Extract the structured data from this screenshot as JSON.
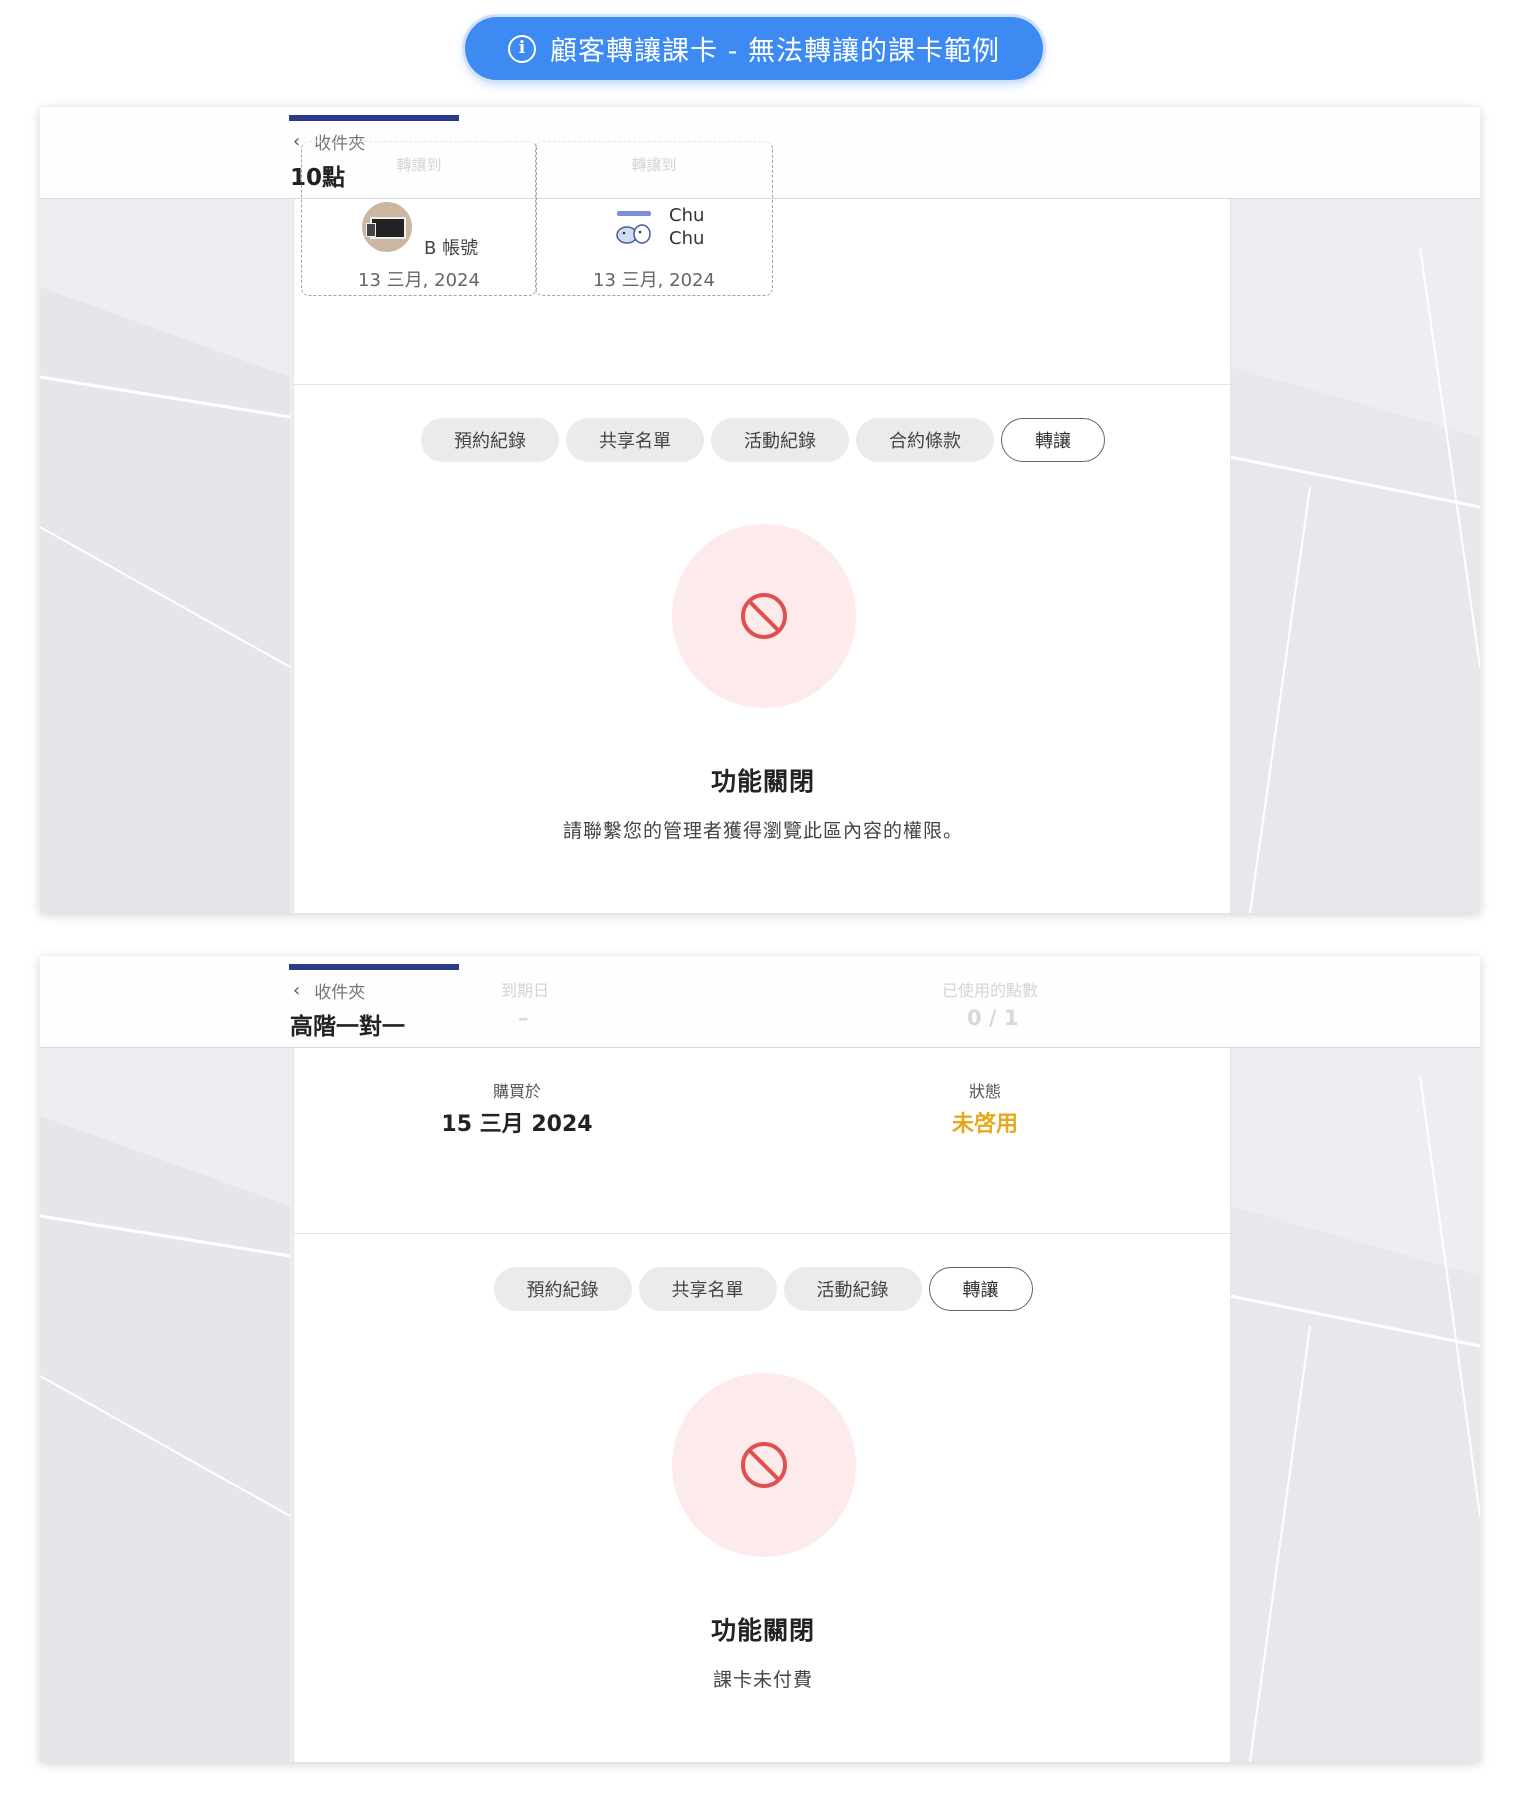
{
  "banner": {
    "icon": "info-icon",
    "text": "顧客轉讓課卡 - 無法轉讓的課卡範例"
  },
  "panel1": {
    "back_label": "收件夾",
    "title": "10點",
    "transfer_cards": [
      {
        "heading": "轉讓到",
        "name": "B 帳號",
        "date": "13 三月, 2024"
      },
      {
        "heading": "轉讓到",
        "name_lines": [
          "Chu",
          "Chu"
        ],
        "date": "13 三月, 2024"
      }
    ],
    "tabs": [
      "預約紀錄",
      "共享名單",
      "活動紀錄",
      "合約條款",
      "轉讓"
    ],
    "active_tab": "轉讓",
    "blocked": {
      "icon": "blocked-icon",
      "title": "功能關閉",
      "message": "請聯繫您的管理者獲得瀏覽此區內容的權限。"
    }
  },
  "panel2": {
    "back_label": "收件夾",
    "title": "高階一對一",
    "faded": {
      "expiry_label": "到期日",
      "expiry_value": "–",
      "points_label": "已使用的點數",
      "points_value": "0 / 1"
    },
    "purchased_label": "購買於",
    "purchased_value": "15 三月 2024",
    "status_label": "狀態",
    "status_value": "未啓用",
    "tabs": [
      "預約紀錄",
      "共享名單",
      "活動紀錄",
      "轉讓"
    ],
    "active_tab": "轉讓",
    "blocked": {
      "icon": "blocked-icon",
      "title": "功能關閉",
      "message": "課卡未付費"
    }
  },
  "colors": {
    "banner": "#3d8bf2",
    "accent_bar": "#2b3a8a",
    "status_warn": "#e6a91b",
    "block_bg": "#fdeaea",
    "block_icon": "#e05050"
  }
}
